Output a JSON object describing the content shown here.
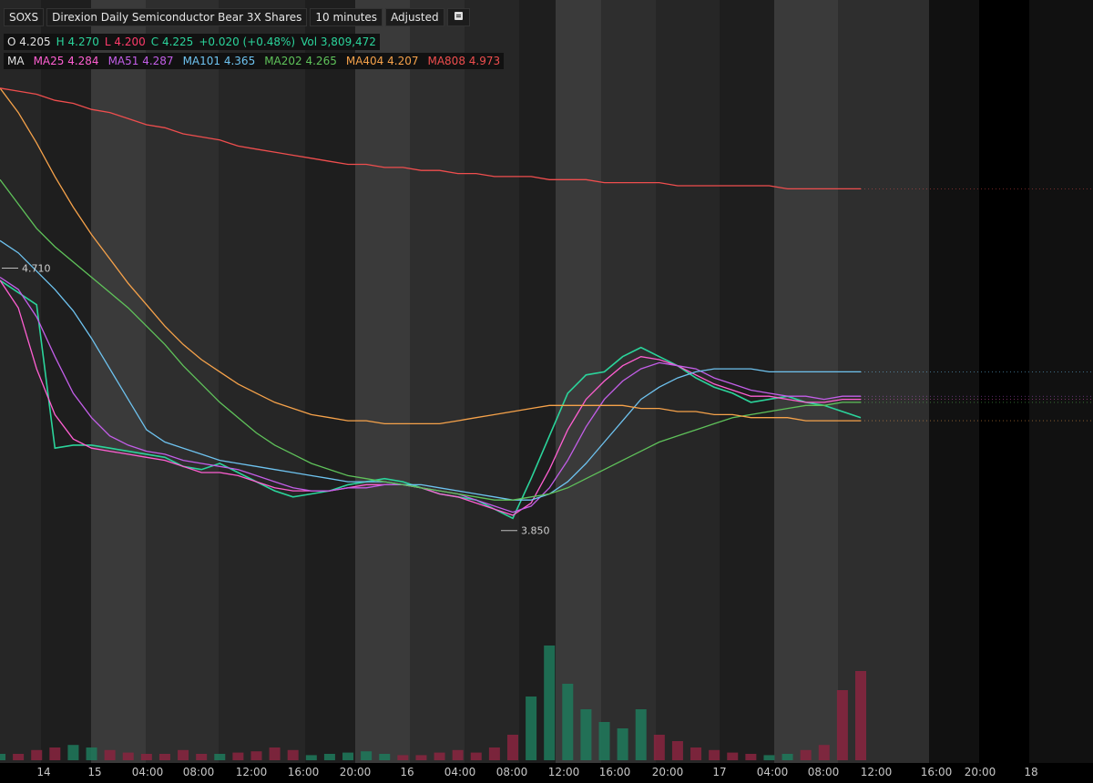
{
  "header": {
    "symbol": "SOXS",
    "description": "Direxion Daily Semiconductor Bear 3X Shares",
    "interval": "10 minutes",
    "adjustment": "Adjusted"
  },
  "ohlc": {
    "o_label": "O",
    "o_value": "4.205",
    "h_label": "H",
    "h_value": "4.270",
    "l_label": "L",
    "l_value": "4.200",
    "c_label": "C",
    "c_value": "4.225",
    "change": "+0.020 (+0.48%)",
    "vol_label": "Vol",
    "vol_value": "3,809,472"
  },
  "ma_legend": {
    "label": "MA",
    "items": [
      {
        "name": "MA25",
        "value": "4.284",
        "color": "#ff5fd2"
      },
      {
        "name": "MA51",
        "value": "4.287",
        "color": "#c35ee8"
      },
      {
        "name": "MA101",
        "value": "4.365",
        "color": "#6ec3f0"
      },
      {
        "name": "MA202",
        "value": "4.265",
        "color": "#5fc25a"
      },
      {
        "name": "MA404",
        "value": "4.207",
        "color": "#f6a24a"
      },
      {
        "name": "MA808",
        "value": "4.973",
        "color": "#ef4e4e"
      }
    ]
  },
  "chart_data": {
    "type": "line",
    "price_range": [
      3.5,
      5.35
    ],
    "x_labels": [
      "14",
      "15",
      "04:00",
      "08:00",
      "12:00",
      "16:00",
      "20:00",
      "16",
      "04:00",
      "08:00",
      "12:00",
      "16:00",
      "20:00",
      "17",
      "04:00",
      "08:00",
      "12:00",
      "16:00",
      "20:00",
      "18"
    ],
    "annotations": [
      {
        "text": "4.710",
        "value": 4.71
      },
      {
        "text": "3.850",
        "value": 3.85
      }
    ],
    "close_series": [
      4.67,
      4.63,
      4.59,
      4.12,
      4.13,
      4.13,
      4.12,
      4.11,
      4.1,
      4.09,
      4.06,
      4.05,
      4.07,
      4.04,
      4.01,
      3.98,
      3.96,
      3.97,
      3.98,
      4.0,
      4.01,
      4.02,
      4.01,
      3.99,
      3.97,
      3.96,
      3.95,
      3.92,
      3.89,
      4.02,
      4.16,
      4.3,
      4.36,
      4.37,
      4.42,
      4.45,
      4.42,
      4.39,
      4.35,
      4.32,
      4.3,
      4.27,
      4.28,
      4.29,
      4.27,
      4.26,
      4.24,
      4.22
    ],
    "series": [
      {
        "name": "MA25",
        "values": [
          4.67,
          4.58,
          4.38,
          4.23,
          4.15,
          4.12,
          4.11,
          4.1,
          4.09,
          4.08,
          4.06,
          4.04,
          4.04,
          4.03,
          4.01,
          3.99,
          3.98,
          3.98,
          3.98,
          3.99,
          4.0,
          4.0,
          4.0,
          3.99,
          3.97,
          3.96,
          3.94,
          3.92,
          3.9,
          3.94,
          4.05,
          4.18,
          4.28,
          4.34,
          4.39,
          4.42,
          4.41,
          4.39,
          4.36,
          4.33,
          4.31,
          4.29,
          4.29,
          4.28,
          4.27,
          4.27,
          4.28,
          4.28
        ]
      },
      {
        "name": "MA51",
        "values": [
          4.68,
          4.64,
          4.55,
          4.42,
          4.3,
          4.22,
          4.16,
          4.13,
          4.11,
          4.1,
          4.08,
          4.07,
          4.06,
          4.05,
          4.03,
          4.01,
          3.99,
          3.98,
          3.98,
          3.99,
          3.99,
          4.0,
          4.0,
          3.99,
          3.98,
          3.97,
          3.95,
          3.93,
          3.91,
          3.93,
          3.99,
          4.08,
          4.19,
          4.28,
          4.34,
          4.38,
          4.4,
          4.39,
          4.38,
          4.35,
          4.33,
          4.31,
          4.3,
          4.29,
          4.29,
          4.28,
          4.29,
          4.29
        ]
      },
      {
        "name": "MA101",
        "values": [
          4.8,
          4.76,
          4.7,
          4.64,
          4.57,
          4.48,
          4.38,
          4.28,
          4.18,
          4.14,
          4.12,
          4.1,
          4.08,
          4.07,
          4.06,
          4.05,
          4.04,
          4.03,
          4.02,
          4.01,
          4.01,
          4.01,
          4.0,
          4.0,
          3.99,
          3.98,
          3.97,
          3.96,
          3.95,
          3.95,
          3.97,
          4.01,
          4.07,
          4.14,
          4.21,
          4.28,
          4.32,
          4.35,
          4.37,
          4.38,
          4.38,
          4.38,
          4.37,
          4.37,
          4.37,
          4.37,
          4.37,
          4.37
        ]
      },
      {
        "name": "MA202",
        "values": [
          5.0,
          4.92,
          4.84,
          4.78,
          4.73,
          4.68,
          4.63,
          4.58,
          4.52,
          4.46,
          4.39,
          4.33,
          4.27,
          4.22,
          4.17,
          4.13,
          4.1,
          4.07,
          4.05,
          4.03,
          4.02,
          4.01,
          4.0,
          3.99,
          3.98,
          3.97,
          3.96,
          3.95,
          3.95,
          3.96,
          3.97,
          3.99,
          4.02,
          4.05,
          4.08,
          4.11,
          4.14,
          4.16,
          4.18,
          4.2,
          4.22,
          4.23,
          4.24,
          4.25,
          4.26,
          4.26,
          4.27,
          4.27
        ]
      },
      {
        "name": "MA404",
        "values": [
          5.3,
          5.22,
          5.12,
          5.01,
          4.91,
          4.82,
          4.74,
          4.66,
          4.59,
          4.52,
          4.46,
          4.41,
          4.37,
          4.33,
          4.3,
          4.27,
          4.25,
          4.23,
          4.22,
          4.21,
          4.21,
          4.2,
          4.2,
          4.2,
          4.2,
          4.21,
          4.22,
          4.23,
          4.24,
          4.25,
          4.26,
          4.26,
          4.26,
          4.26,
          4.26,
          4.25,
          4.25,
          4.24,
          4.24,
          4.23,
          4.23,
          4.22,
          4.22,
          4.22,
          4.21,
          4.21,
          4.21,
          4.21
        ]
      },
      {
        "name": "MA808",
        "values": [
          5.3,
          5.29,
          5.28,
          5.26,
          5.25,
          5.23,
          5.22,
          5.2,
          5.18,
          5.17,
          5.15,
          5.14,
          5.13,
          5.11,
          5.1,
          5.09,
          5.08,
          5.07,
          5.06,
          5.05,
          5.05,
          5.04,
          5.04,
          5.03,
          5.03,
          5.02,
          5.02,
          5.01,
          5.01,
          5.01,
          5.0,
          5.0,
          5.0,
          4.99,
          4.99,
          4.99,
          4.99,
          4.98,
          4.98,
          4.98,
          4.98,
          4.98,
          4.98,
          4.97,
          4.97,
          4.97,
          4.97,
          4.97
        ]
      }
    ],
    "volume_relative": [
      0.05,
      0.05,
      0.08,
      0.1,
      0.12,
      0.1,
      0.08,
      0.06,
      0.05,
      0.05,
      0.08,
      0.05,
      0.05,
      0.06,
      0.07,
      0.1,
      0.08,
      0.04,
      0.05,
      0.06,
      0.07,
      0.05,
      0.04,
      0.04,
      0.06,
      0.08,
      0.06,
      0.1,
      0.2,
      0.5,
      0.9,
      0.6,
      0.4,
      0.3,
      0.25,
      0.4,
      0.2,
      0.15,
      0.1,
      0.08,
      0.06,
      0.05,
      0.04,
      0.05,
      0.08,
      0.12,
      0.55,
      0.7
    ],
    "grid": false,
    "legend": "top-left"
  }
}
